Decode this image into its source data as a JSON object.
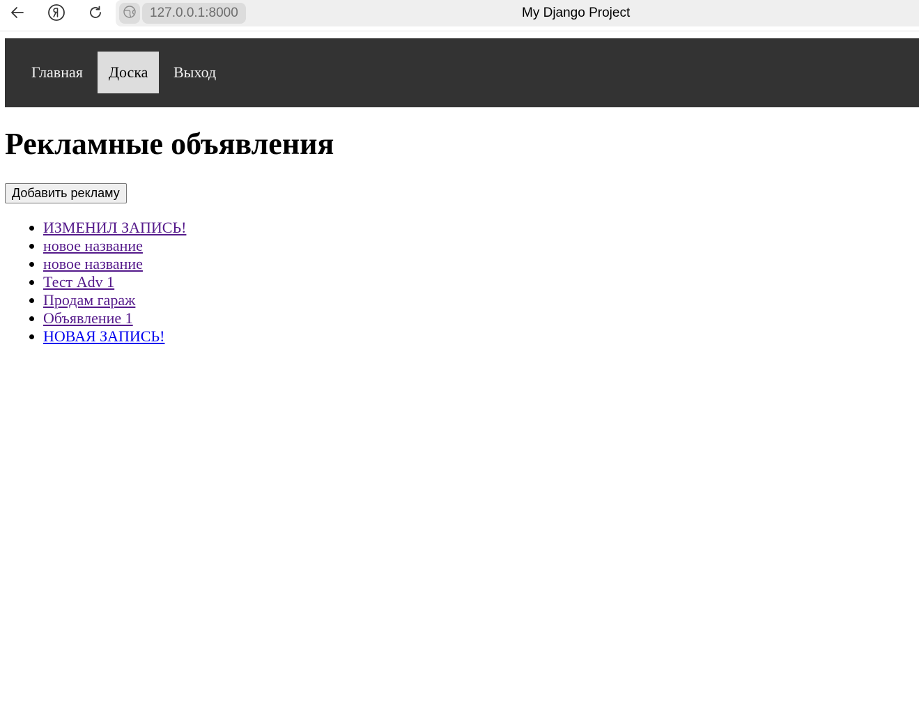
{
  "browser": {
    "url": "127.0.0.1:8000",
    "tab_title": "My Django Project",
    "back_icon": "arrow-left-icon",
    "yandex_icon": "yandex-logo-icon",
    "reload_icon": "reload-icon",
    "site_icon": "globe-icon"
  },
  "nav": {
    "items": [
      {
        "label": "Главная",
        "active": false
      },
      {
        "label": "Доска",
        "active": true
      },
      {
        "label": "Выход",
        "active": false
      }
    ],
    "background": "#333333",
    "active_background": "#dddddd"
  },
  "main": {
    "title": "Рекламные объявления",
    "add_button": "Добавить рекламу",
    "ads": [
      {
        "title": "ИЗМЕНИЛ ЗАПИСЬ!",
        "visited": true
      },
      {
        "title": "новое название",
        "visited": true
      },
      {
        "title": "новое название",
        "visited": true
      },
      {
        "title": "Тест Adv 1",
        "visited": true
      },
      {
        "title": "Продам гараж",
        "visited": true
      },
      {
        "title": "Объявление 1",
        "visited": true
      },
      {
        "title": "НОВАЯ ЗАПИСЬ!",
        "visited": false
      }
    ],
    "visited_link_color": "#551a8b",
    "link_color": "#0000ee"
  }
}
